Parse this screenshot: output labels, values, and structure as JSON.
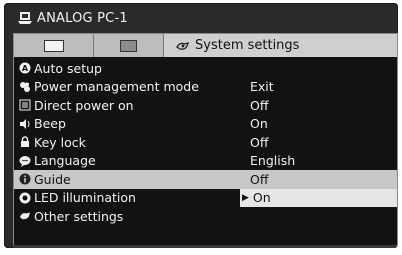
{
  "header": {
    "title": "ANALOG PC-1",
    "icon": "pc-monitor-icon"
  },
  "tabs": [
    {
      "label": "",
      "icon": "tab-white-square-icon"
    },
    {
      "label": "",
      "icon": "tab-grey-square-icon"
    },
    {
      "label": "System settings",
      "icon": "system-settings-icon"
    }
  ],
  "menu": {
    "items": [
      {
        "label": "Auto setup",
        "value": "",
        "icon": "auto-setup-icon"
      },
      {
        "label": "Power management mode",
        "value": "Exit",
        "icon": "power-management-icon"
      },
      {
        "label": "Direct power on",
        "value": "Off",
        "icon": "direct-power-icon"
      },
      {
        "label": "Beep",
        "value": "On",
        "icon": "speaker-icon"
      },
      {
        "label": "Key lock",
        "value": "Off",
        "icon": "lock-icon"
      },
      {
        "label": "Language",
        "value": "English",
        "icon": "speech-bubble-icon"
      },
      {
        "label": "Guide",
        "value": "Off",
        "icon": "info-icon"
      },
      {
        "label": "LED illumination",
        "value": "On",
        "icon": "led-icon",
        "value_prefix": "▶"
      },
      {
        "label": "Other settings",
        "value": "",
        "icon": "other-settings-icon"
      }
    ],
    "selected_index": 6,
    "editing_index": 7
  },
  "colors": {
    "frame": "#2a2a2a",
    "panel": "#121212",
    "selected_row": "#c7c7c7",
    "edit_value_box": "#e6e6e6",
    "text": "#f2f2f2"
  }
}
